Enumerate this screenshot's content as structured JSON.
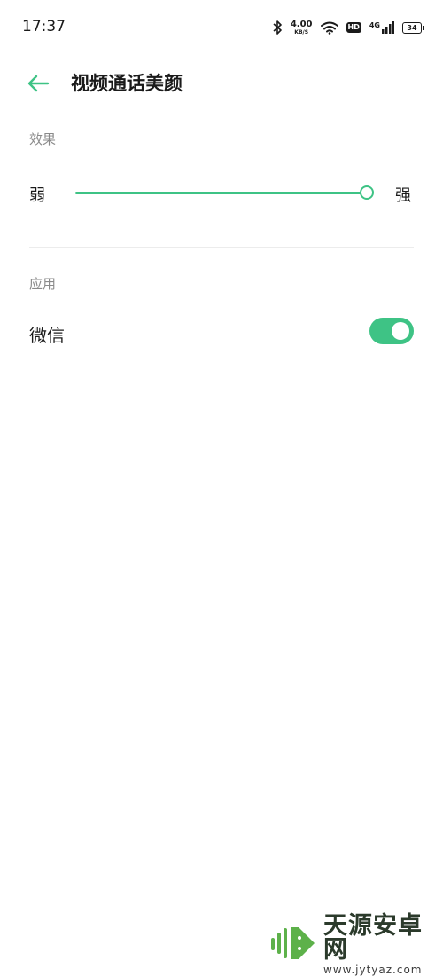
{
  "status_bar": {
    "time": "17:37",
    "net_speed_value": "4.00",
    "net_speed_unit": "KB/S",
    "hd_label": "HD",
    "signal_label": "4G",
    "battery_level": "34"
  },
  "header": {
    "title": "视频通话美颜"
  },
  "effect_section": {
    "label": "效果",
    "slider_min_label": "弱",
    "slider_max_label": "强",
    "slider_value": 1.0
  },
  "apps_section": {
    "label": "应用",
    "items": [
      {
        "name": "微信",
        "enabled": true
      }
    ]
  },
  "watermark": {
    "brand_text": "天源安卓网",
    "url": "www.jytyaz.com"
  },
  "colors": {
    "accent": "#3ec385",
    "secondary_text": "#8a8a8a",
    "primary_text": "#1a1a1a",
    "divider": "#ececec"
  }
}
